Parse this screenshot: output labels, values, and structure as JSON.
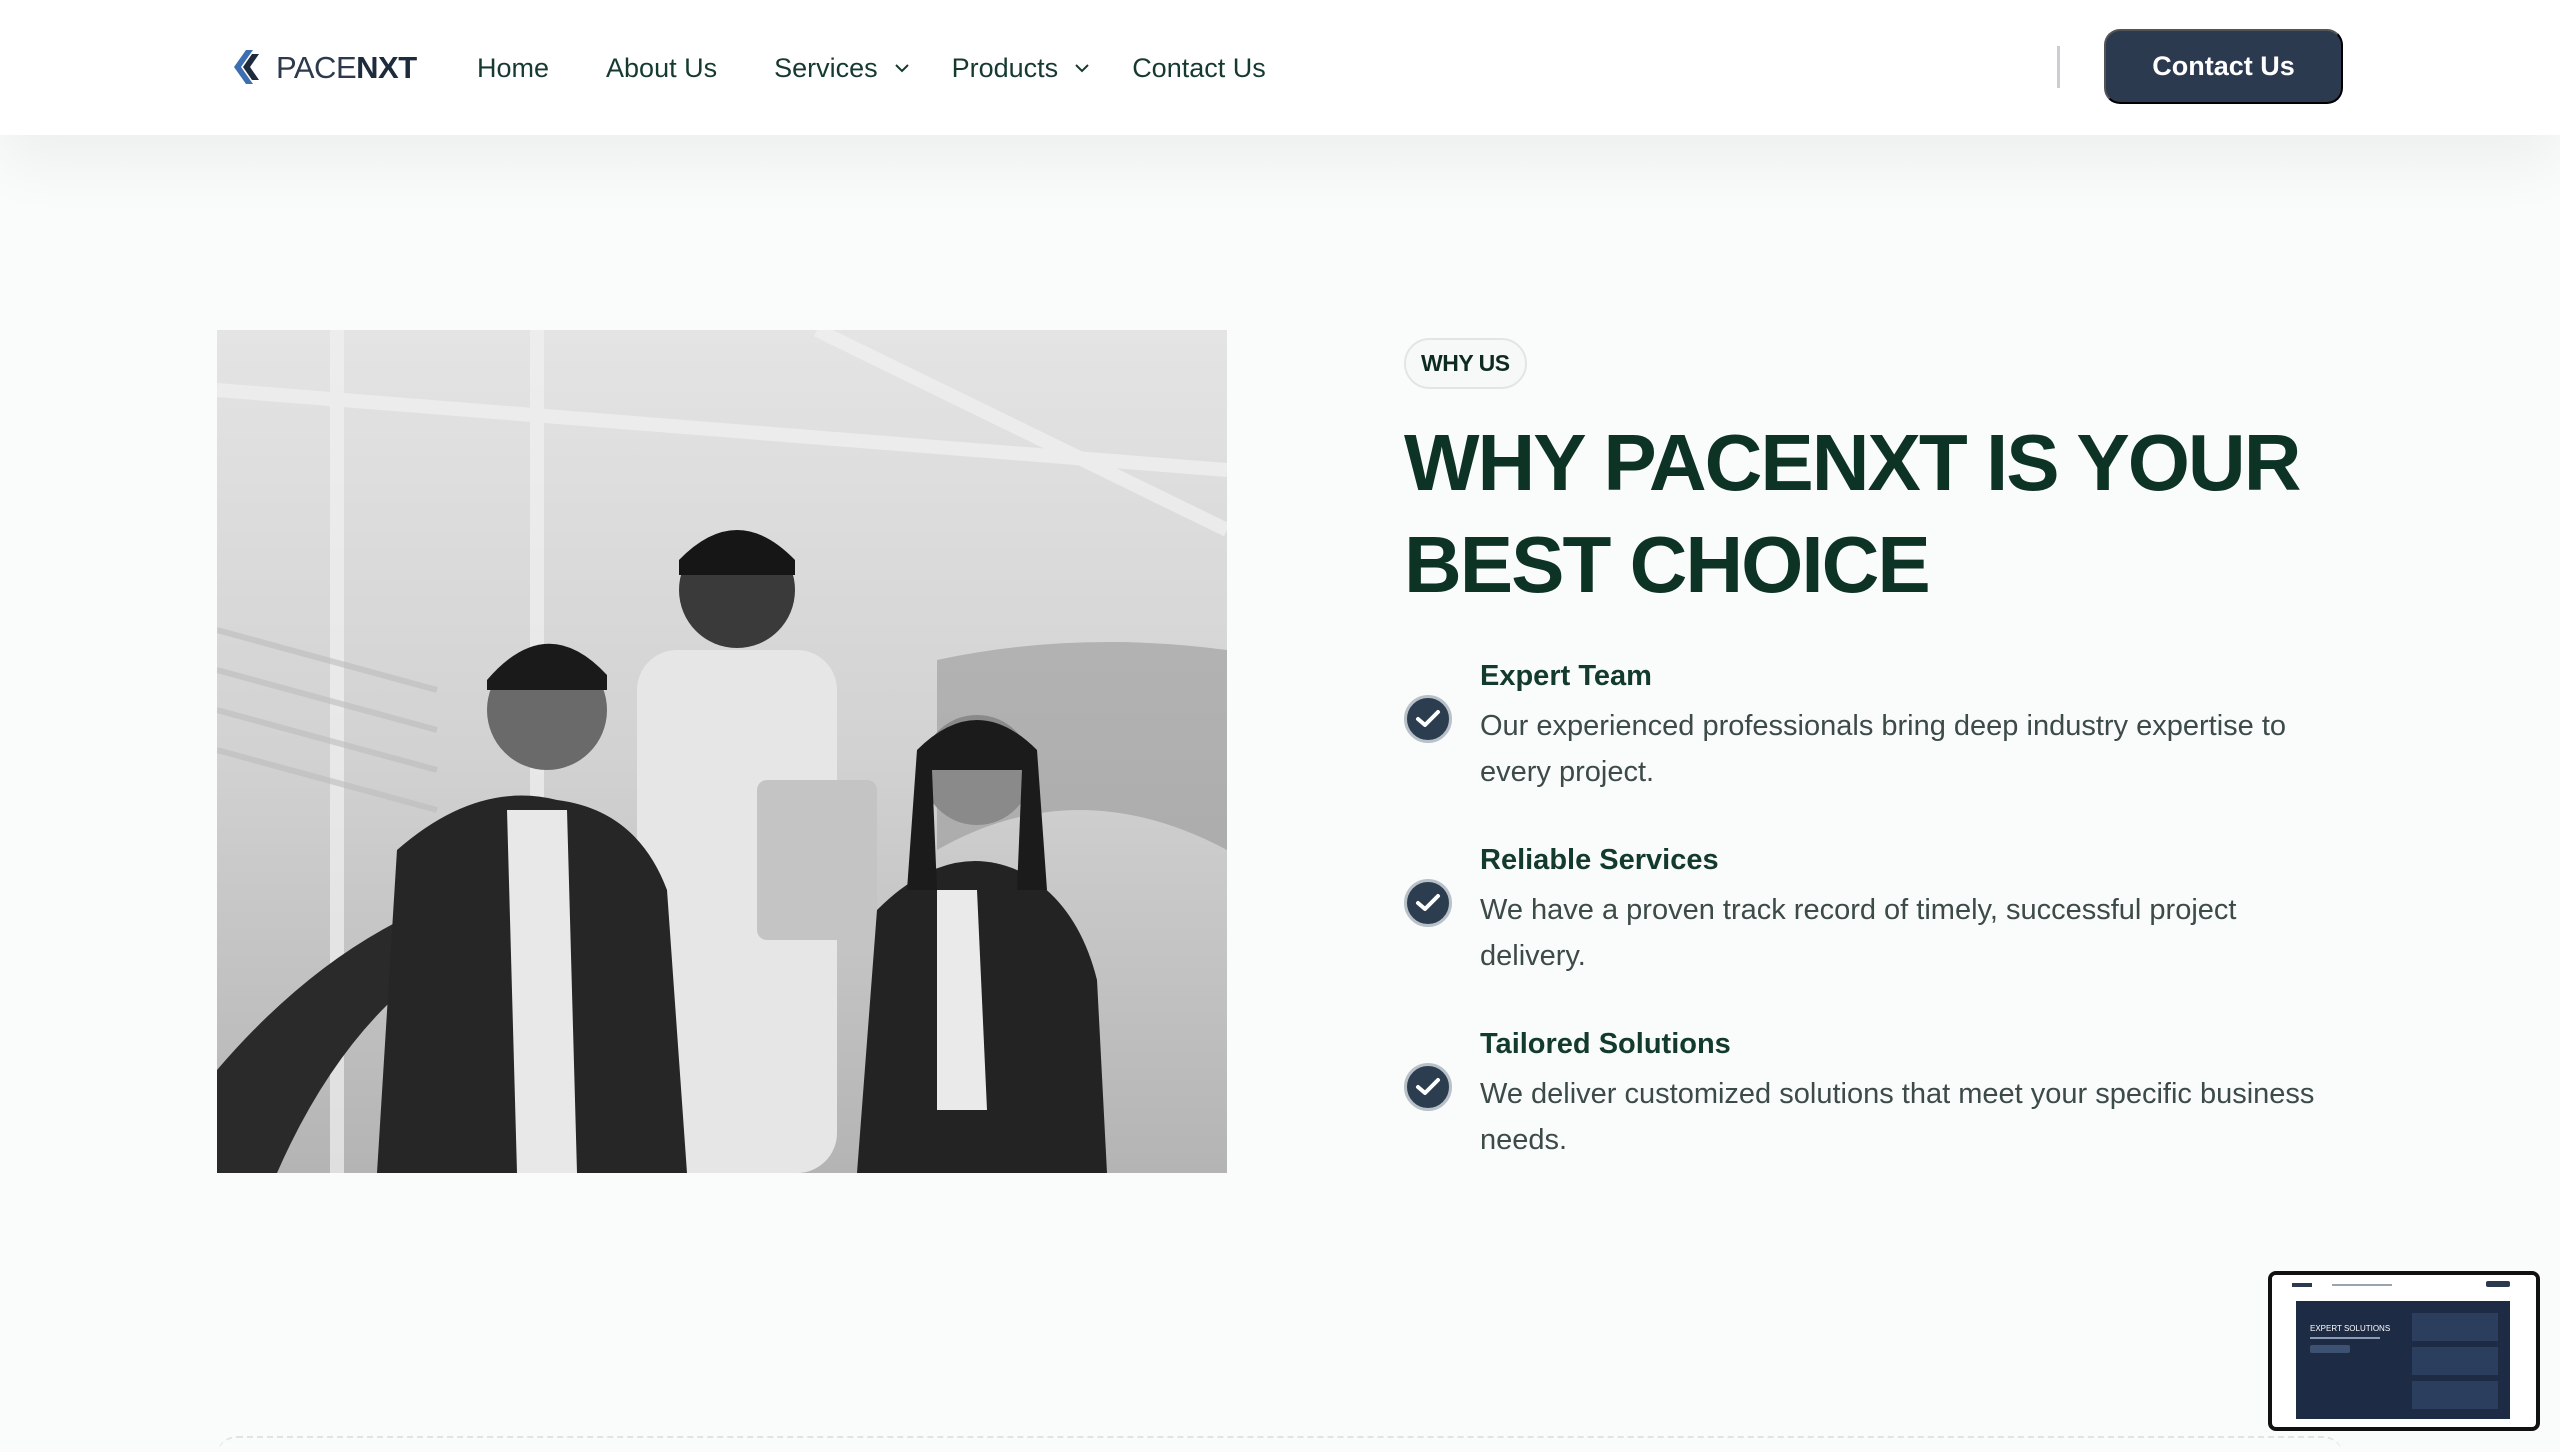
{
  "brand": {
    "name_part1": "PACE",
    "name_part2": "NXT"
  },
  "nav": {
    "items": [
      {
        "label": "Home",
        "has_dropdown": false
      },
      {
        "label": "About Us",
        "has_dropdown": false
      },
      {
        "label": "Services",
        "has_dropdown": true
      },
      {
        "label": "Products",
        "has_dropdown": true
      },
      {
        "label": "Contact Us",
        "has_dropdown": false
      }
    ],
    "cta_label": "Contact Us"
  },
  "section": {
    "badge": "WHY US",
    "heading_line1": "WHY PACENXT IS YOUR",
    "heading_line2": "BEST CHOICE",
    "features": [
      {
        "title": "Expert Team",
        "description": "Our experienced professionals bring deep industry expertise to every project."
      },
      {
        "title": "Reliable Services",
        "description": "We have a proven track record of timely, successful project delivery."
      },
      {
        "title": "Tailored Solutions",
        "description": "We deliver customized solutions that meet your specific business needs."
      }
    ]
  },
  "preview": {
    "title": "EXPERT SOLUTIONS"
  },
  "colors": {
    "primary": "#2c3a4f",
    "heading": "#0d3325",
    "text": "#3c4a48"
  }
}
